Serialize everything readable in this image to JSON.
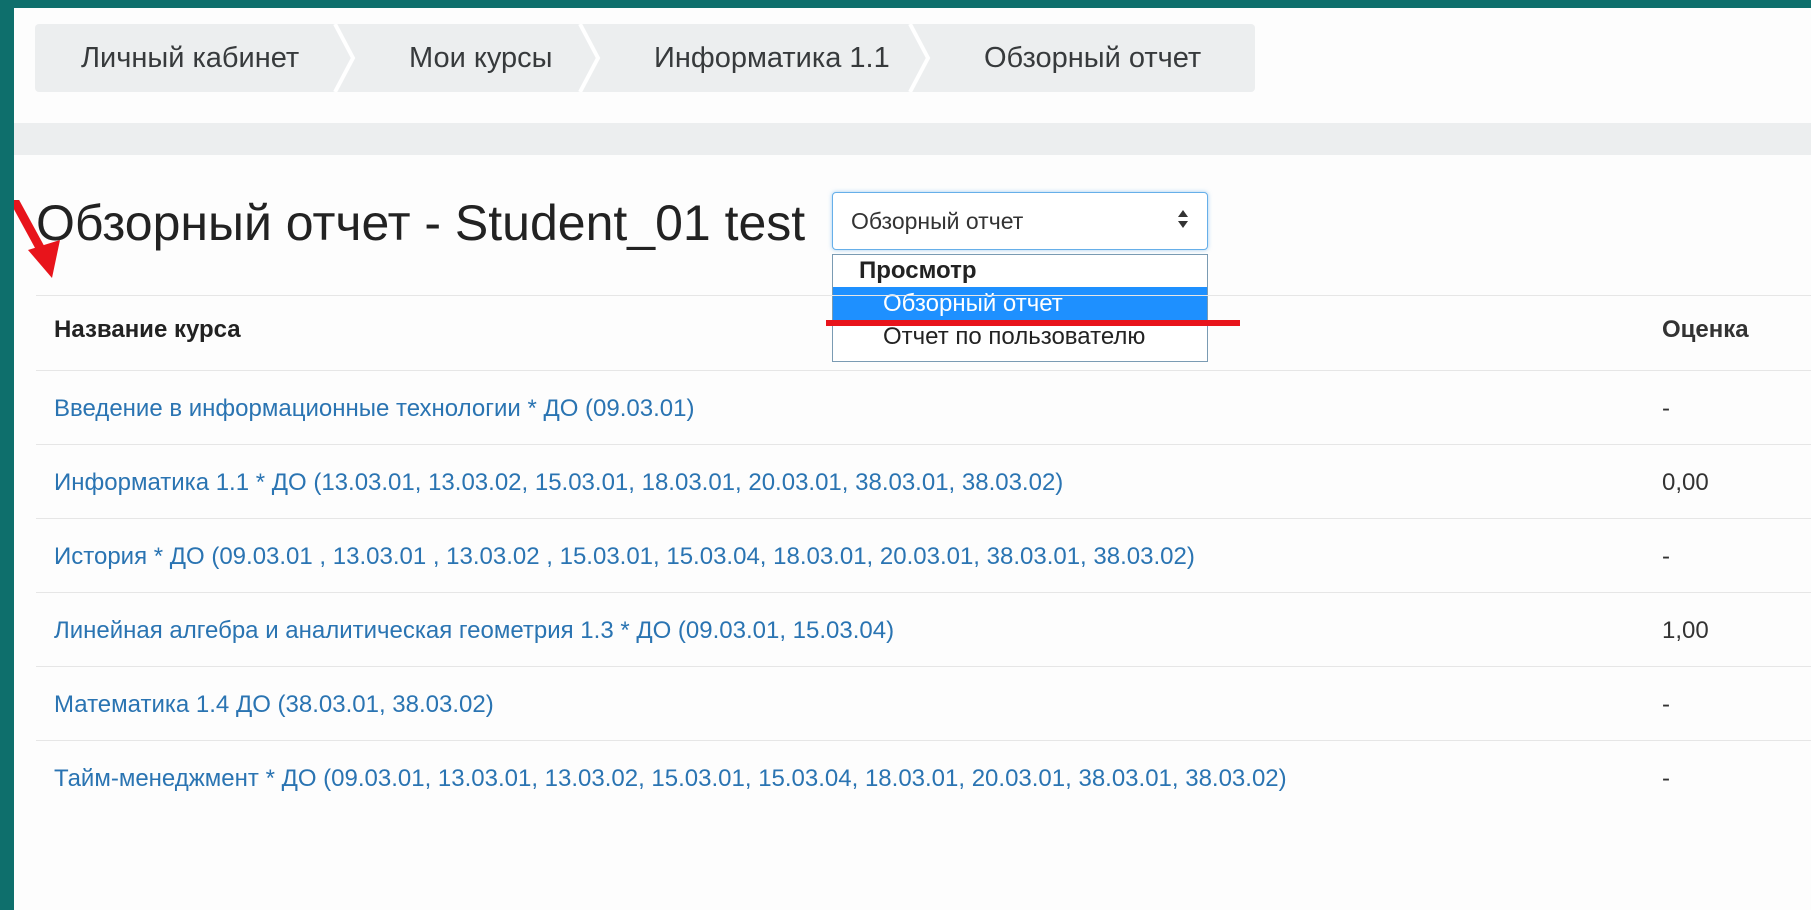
{
  "breadcrumb": [
    "Личный кабинет",
    "Мои курсы",
    "Информатика 1.1",
    "Обзорный отчет"
  ],
  "page_title": "Обзорный отчет - Student_01 test",
  "report_select": {
    "value": "Обзорный отчет",
    "group_label": "Просмотр",
    "options": [
      "Обзорный отчет",
      "Отчет по пользователю"
    ],
    "selected_index": 0
  },
  "table": {
    "headers": {
      "course": "Название курса",
      "grade": "Оценка"
    },
    "rows": [
      {
        "course": "Введение в информационные технологии * ДО (09.03.01)",
        "grade": "-"
      },
      {
        "course": "Информатика 1.1 * ДО (13.03.01, 13.03.02, 15.03.01, 18.03.01, 20.03.01, 38.03.01, 38.03.02)",
        "grade": "0,00"
      },
      {
        "course": "История * ДО (09.03.01 , 13.03.01 , 13.03.02 , 15.03.01, 15.03.04, 18.03.01, 20.03.01, 38.03.01, 38.03.02)",
        "grade": "-"
      },
      {
        "course": "Линейная алгебра и аналитическая геометрия 1.3 * ДО (09.03.01, 15.03.04)",
        "grade": "1,00"
      },
      {
        "course": "Математика 1.4 ДО (38.03.01, 38.03.02)",
        "grade": "-"
      },
      {
        "course": "Тайм-менеджмент * ДО (09.03.01, 13.03.01, 13.03.02, 15.03.01, 15.03.04, 18.03.01, 20.03.01, 38.03.01, 38.03.02)",
        "grade": "-"
      }
    ]
  },
  "colors": {
    "frame": "#0e6f6c",
    "link": "#2a74b2",
    "highlight": "#1e90ff",
    "annotation": "#e8141b"
  }
}
